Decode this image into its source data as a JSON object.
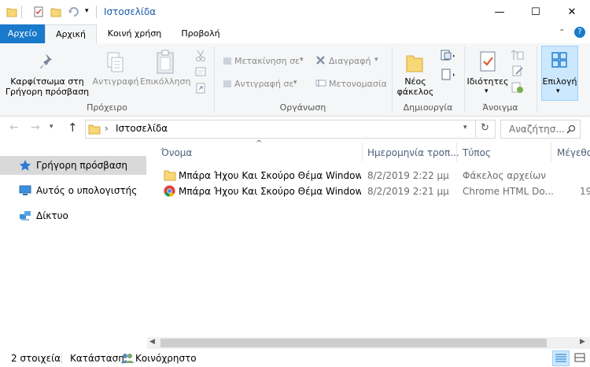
{
  "window": {
    "title": "Ιστοσελίδα",
    "minimize": "—",
    "maximize": "☐",
    "close": "✕"
  },
  "tabs": [
    {
      "label": "Αρχείο"
    },
    {
      "label": "Αρχική"
    },
    {
      "label": "Κοινή χρήση"
    },
    {
      "label": "Προβολή"
    }
  ],
  "ribbon": {
    "clipboard": {
      "pin_line1": "Καρφίτσωμα στη",
      "pin_line2": "Γρήγορη πρόσβαση",
      "copy": "Αντιγραφή",
      "paste": "Επικόλληση",
      "group": "Πρόχειρο"
    },
    "organize": {
      "move_to": "Μετακίνηση σε",
      "copy_to": "Αντιγραφή σε",
      "delete": "Διαγραφή",
      "rename": "Μετονομασία",
      "group": "Οργάνωση"
    },
    "new": {
      "new_folder_line1": "Νέος",
      "new_folder_line2": "φάκελος",
      "group": "Δημιουργία"
    },
    "open": {
      "properties": "Ιδιότητες",
      "group": "Άνοιγμα"
    },
    "select": {
      "select": "Επιλογή"
    }
  },
  "address": {
    "path": "Ιστοσελίδα",
    "separator": "›",
    "search_placeholder": "Αναζήτησ..."
  },
  "nav": [
    {
      "label": "Γρήγορη πρόσβαση"
    },
    {
      "label": "Αυτός ο υπολογιστής"
    },
    {
      "label": "Δίκτυο"
    }
  ],
  "columns": [
    "Όνομα",
    "Ημερομηνία τροπ...",
    "Τύπος",
    "Μέγεθο"
  ],
  "files": [
    {
      "name": "Μπάρα Ήχου Και Σκούρο Θέμα Window...",
      "date": "8/2/2019 2:22 μμ",
      "type": "Φάκελος αρχείων",
      "size": ""
    },
    {
      "name": "Μπάρα Ήχου Και Σκούρο Θέμα Window...",
      "date": "8/2/2019 2:21 μμ",
      "type": "Chrome HTML Do...",
      "size": "19"
    }
  ],
  "status": {
    "count": "2 στοιχεία",
    "state_label": "Κατάσταση:",
    "state_value": "Κοινόχρηστο"
  },
  "colors": {
    "accent": "#1979ca",
    "folder": "#f8d775",
    "selected": "#cce8ff"
  }
}
